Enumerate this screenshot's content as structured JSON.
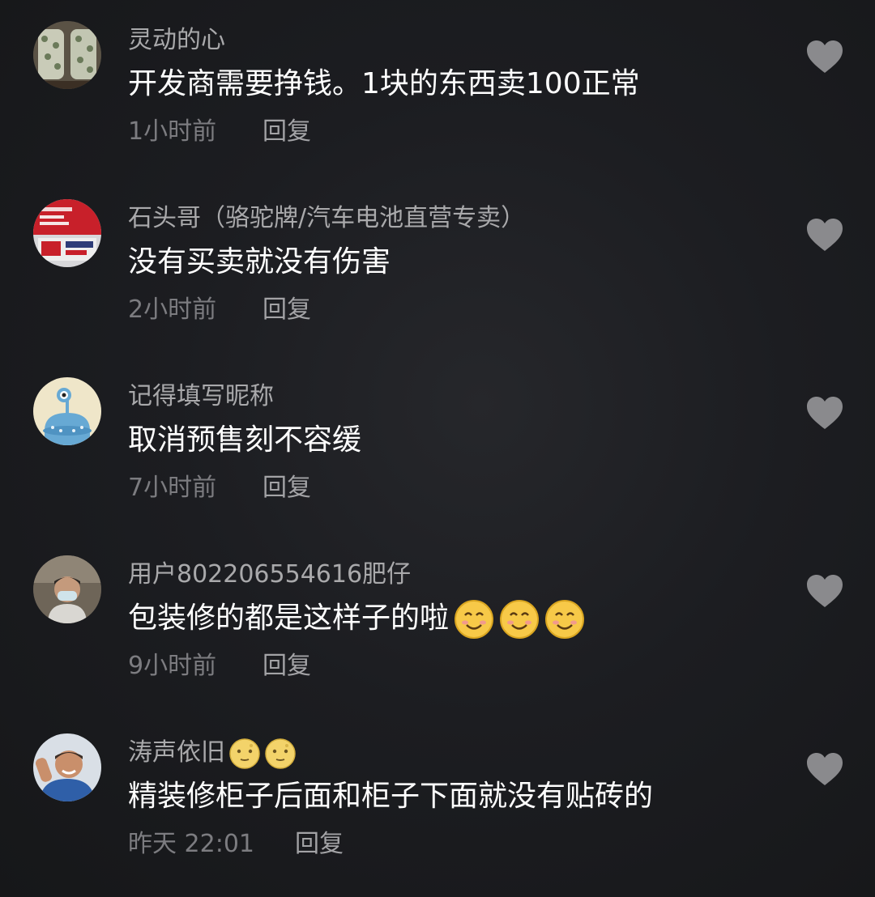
{
  "comments": [
    {
      "username": "灵动的心",
      "text": "开发商需要挣钱。1块的东西卖100正常",
      "time": "1小时前",
      "reply_label": "回复",
      "avatar_icon": "avatar-pattern-icon"
    },
    {
      "username": "石头哥（骆驼牌/汽车电池直营专卖）",
      "text": "没有买卖就没有伤害",
      "time": "2小时前",
      "reply_label": "回复",
      "avatar_icon": "avatar-battery-icon"
    },
    {
      "username": "记得填写昵称",
      "text": "取消预售刻不容缓",
      "time": "7小时前",
      "reply_label": "回复",
      "avatar_icon": "avatar-alien-icon"
    },
    {
      "username": "用户802206554616肥仔",
      "text": "包装修的都是这样子的啦",
      "time": "9小时前",
      "reply_label": "回复",
      "avatar_icon": "avatar-person-mask-icon",
      "text_emoji": [
        "smile-emoji-icon",
        "smile-emoji-icon",
        "smile-emoji-icon"
      ]
    },
    {
      "username": "涛声依旧",
      "text": "精装修柜子后面和柜子下面就没有贴砖的",
      "time": "昨天 22:01",
      "reply_label": "回复",
      "avatar_icon": "avatar-person-icon",
      "name_emoji": [
        "moon-face-emoji-icon",
        "moon-face-emoji-icon"
      ]
    }
  ],
  "like_icon": "heart-icon",
  "colors": {
    "background": "#1c1d21",
    "username": "#a9a9ab",
    "text": "#ffffff",
    "meta": "#7c7c80",
    "like": "#8a8a8d"
  }
}
